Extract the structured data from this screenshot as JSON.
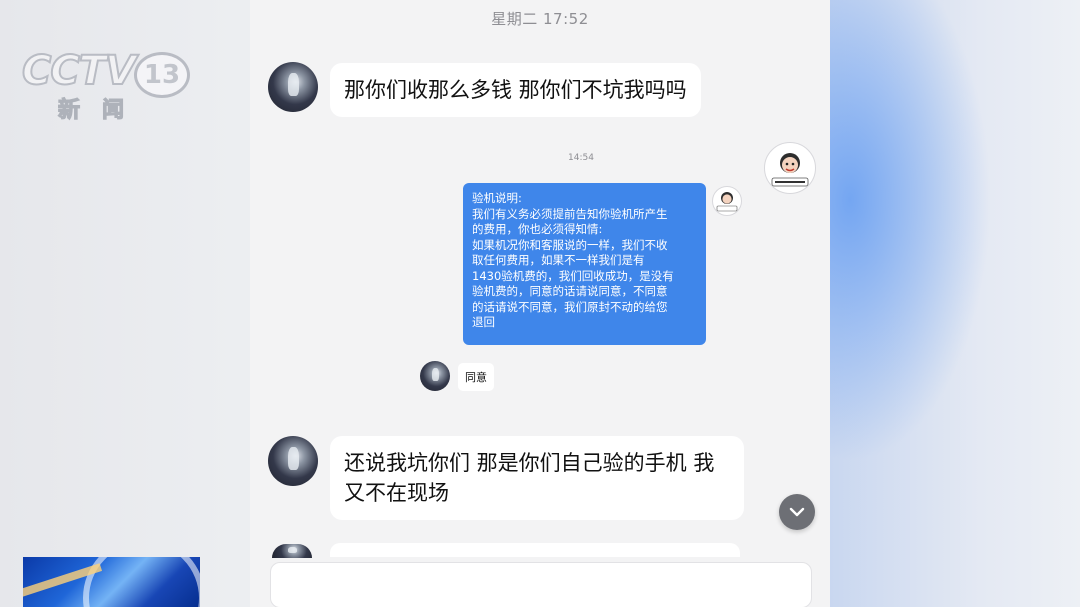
{
  "watermark": {
    "channel_logo": "CCTV",
    "channel_number": "13",
    "channel_sub": "新闻"
  },
  "chat": {
    "header_time": "星期二 17:52",
    "messages": [
      {
        "sender": "customer",
        "text": "那你们收那么多钱 那你们不坑我吗吗"
      },
      {
        "sender": "shop",
        "screenshot": {
          "time": "14:54",
          "notice": "验机说明:\n我们有义务必须提前告知你验机所产生\n的费用，你也必须得知情:\n如果机况你和客服说的一样，我们不收\n取任何费用，如果不一样我们是有\n1430验机费的，我们回收成功，是没有\n验机费的，同意的话请说同意，不同意\n的话请说不同意，我们原封不动的给您\n退回",
          "reply": "同意"
        }
      },
      {
        "sender": "customer",
        "text": "还说我坑你们 那是你们自己验的手机 我\n又不在现场"
      }
    ]
  },
  "colors": {
    "notice_bubble": "#3f86ea",
    "page_bg": "#f3f3f4",
    "glow": "#74a6f2"
  },
  "icons": {
    "scroll_down": "chevron-down-icon"
  }
}
